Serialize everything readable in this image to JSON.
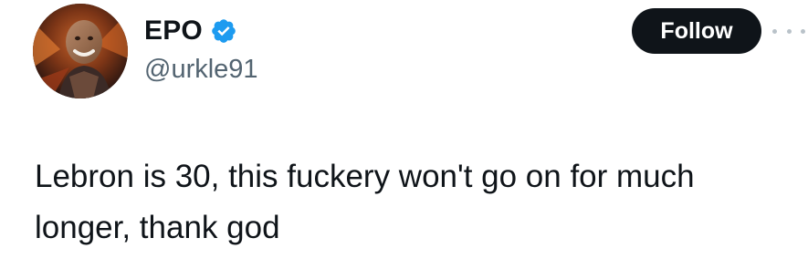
{
  "author": {
    "display_name": "EPO",
    "handle": "@urkle91",
    "verified": true
  },
  "actions": {
    "follow_label": "Follow",
    "more_icon": "more-horizontal-icon"
  },
  "tweet": {
    "text": "Lebron is 30, this fuckery won't go on for much\nlonger, thank god"
  },
  "colors": {
    "text_primary": "#0f1419",
    "text_secondary": "#536471",
    "verified_blue": "#1d9bf0",
    "follow_bg": "#0f1419",
    "follow_text": "#ffffff"
  }
}
